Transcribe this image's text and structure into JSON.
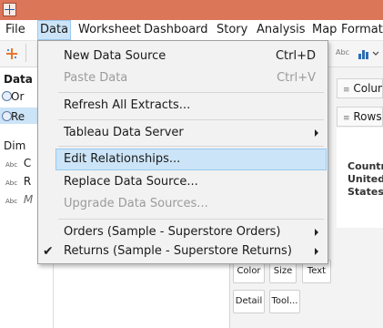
{
  "menubar": {
    "items": [
      {
        "label": "File"
      },
      {
        "label": "Data"
      },
      {
        "label": "Worksheet"
      },
      {
        "label": "Dashboard"
      },
      {
        "label": "Story"
      },
      {
        "label": "Analysis"
      },
      {
        "label": "Map"
      },
      {
        "label": "Format"
      }
    ]
  },
  "left_pane": {
    "header": "Data",
    "source_1": "Or",
    "source_2": "Re",
    "dimensions_header": "Dim",
    "fields": [
      {
        "type": "Abc",
        "name": "C"
      },
      {
        "type": "Abc",
        "name": "R"
      },
      {
        "type": "Abc",
        "name": "M"
      }
    ]
  },
  "shelves": {
    "columns": "Colum",
    "rows": "Rows",
    "toolbar_abc": "Abc"
  },
  "canvas": {
    "header_line1": "Countr",
    "header_line2": "United",
    "header_line3": "States"
  },
  "marks": {
    "buttons": [
      "Color",
      "Size",
      "Text",
      "Detail",
      "Tool..."
    ]
  },
  "data_menu": {
    "items": [
      {
        "label": "New Data Source",
        "shortcut": "Ctrl+D",
        "disabled": false
      },
      {
        "label": "Paste Data",
        "shortcut": "Ctrl+V",
        "disabled": true
      },
      {
        "label": "Refresh All Extracts...",
        "shortcut": "",
        "disabled": false
      },
      {
        "label": "Tableau Data Server",
        "shortcut": "",
        "disabled": false,
        "submenu": true
      },
      {
        "label": "Edit Relationships...",
        "shortcut": "",
        "disabled": false,
        "highlighted": true
      },
      {
        "label": "Replace Data Source...",
        "shortcut": "",
        "disabled": false
      },
      {
        "label": "Upgrade Data Sources...",
        "shortcut": "",
        "disabled": true
      },
      {
        "label": "Orders (Sample - Superstore Orders)",
        "shortcut": "",
        "disabled": false,
        "submenu": true
      },
      {
        "label": "Returns (Sample - Superstore Returns)",
        "shortcut": "",
        "disabled": false,
        "submenu": true,
        "checked": true
      }
    ]
  },
  "colors": {
    "titlebar": "#dc7659",
    "highlight": "#cce4f7"
  }
}
